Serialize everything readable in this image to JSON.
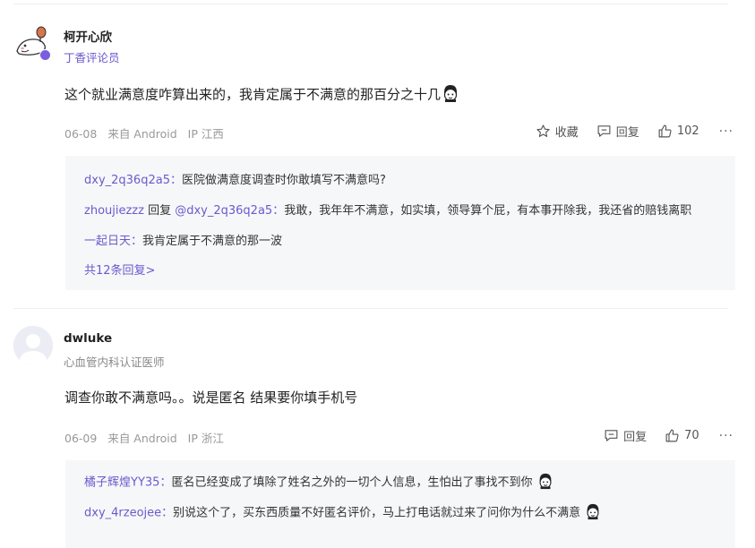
{
  "comments": [
    {
      "username": "柯开心欣",
      "role": "丁香评论员",
      "text": "这个就业满意度咋算出来的，我肯定属于不满意的那百分之十几",
      "date": "06-08",
      "source": "来自 Android",
      "ip": "IP 江西",
      "actions": {
        "favorite": "收藏",
        "reply": "回复",
        "likes": "102"
      },
      "replies": [
        {
          "user": "dxy_2q36q2a5",
          "sep": "：",
          "text": "医院做满意度调查时你敢填写不满意吗?"
        },
        {
          "user": "zhoujiezzz",
          "reply_word": " 回复 ",
          "target": "@dxy_2q36q2a5",
          "sep": "：",
          "text": "我敢，我年年不满意，如实填，领导算个屁，有本事开除我，我还省的赔钱离职"
        },
        {
          "user": "一起日天",
          "sep": "：",
          "text": "我肯定属于不满意的那一波"
        }
      ],
      "more_replies": "共12条回复>"
    },
    {
      "username": "dwluke",
      "role": "心血管内科认证医师",
      "text": "调查你敢不满意吗。。说是匿名 结果要你填手机号",
      "date": "06-09",
      "source": "来自 Android",
      "ip": "IP 浙江",
      "actions": {
        "reply": "回复",
        "likes": "70"
      },
      "replies": [
        {
          "user": "橘子辉煌YY35",
          "sep": "：",
          "text": "匿名已经变成了填除了姓名之外的一切个人信息，生怕出了事找不到你"
        },
        {
          "user": "dxy_4rzeojee",
          "sep": "：",
          "text": "别说这个了，买东西质量不好匿名评价，马上打电话就过来了问你为什么不满意"
        }
      ]
    }
  ],
  "colors": {
    "accent": "#6a5acd",
    "reply_bg": "#f6f7f9",
    "meta": "#999999"
  },
  "icons": [
    "star-icon",
    "comment-icon",
    "thumbs-up-icon",
    "more-dots-icon",
    "emoji-icon",
    "verified-badge-icon"
  ]
}
